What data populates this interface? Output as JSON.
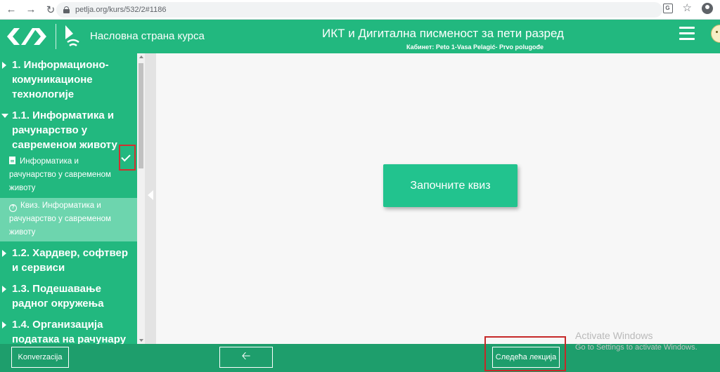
{
  "browser": {
    "back_icon": "arrow-left-icon",
    "url": "petlja.org/kurs/532/2#1186"
  },
  "header": {
    "course_home": "Насловна страна курса",
    "course_title": "ИКТ и Дигитална писменост за пети разред",
    "cabinet": "Кабинет: Peto 1-Vasa Pelagić- Prvo polugođe",
    "accent_color": "#22b87f"
  },
  "sidebar": {
    "sections": [
      {
        "label": "1. Информационо-комуникационе технологије",
        "state": "collapsed"
      },
      {
        "label": "1.1. Информатика и рачунарство у савременом животу",
        "state": "expanded"
      },
      {
        "label": "1.2. Хардвер, софтвер и сервиси",
        "state": "collapsed"
      },
      {
        "label": "1.3. Подешавање радног окружења",
        "state": "collapsed"
      },
      {
        "label": "1.4. Организација података на рачунару",
        "state": "collapsed"
      }
    ],
    "lessons": [
      {
        "label": "Информатика и рачунарство у савременом животу",
        "icon": "document-icon",
        "completed": true
      },
      {
        "label": "Квиз. Информатика и рачунарство у савременом животу",
        "icon": "quiz-icon",
        "active": true
      }
    ]
  },
  "main": {
    "start_quiz": "Започните квиз"
  },
  "footer": {
    "conversation": "Konverzacija",
    "back_icon": "arrow-left-icon",
    "next_lesson": "Следећа лекција"
  },
  "overlay": {
    "activate_title": "Activate Windows",
    "activate_sub": "Go to Settings to activate Windows."
  }
}
